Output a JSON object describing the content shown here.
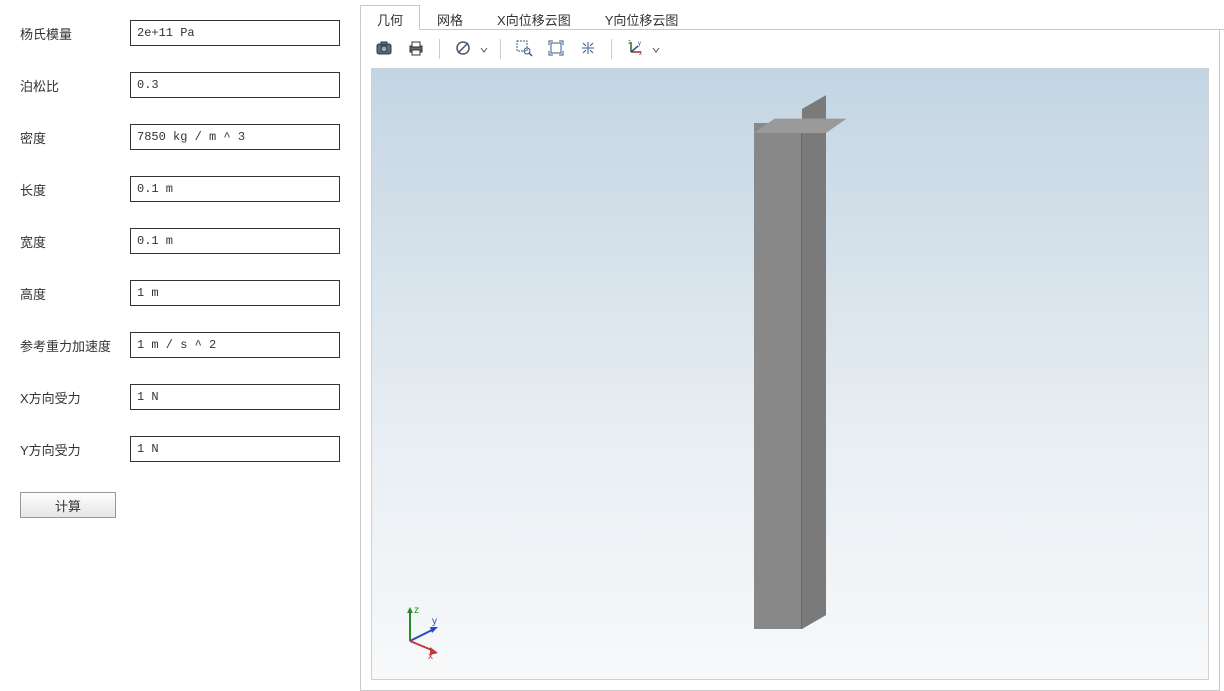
{
  "form": {
    "youngs_modulus": {
      "label": "杨氏模量",
      "value": "2e+11 Pa"
    },
    "poisson_ratio": {
      "label": "泊松比",
      "value": "0.3"
    },
    "density": {
      "label": "密度",
      "value": "7850 kg / m ^ 3"
    },
    "length": {
      "label": "长度",
      "value": "0.1 m"
    },
    "width": {
      "label": "宽度",
      "value": "0.1 m"
    },
    "height": {
      "label": "高度",
      "value": "1 m"
    },
    "gravity": {
      "label": "参考重力加速度",
      "value": "1 m / s ^ 2"
    },
    "force_x": {
      "label": "X方向受力",
      "value": "1 N"
    },
    "force_y": {
      "label": "Y方向受力",
      "value": "1 N"
    }
  },
  "compute_button": "计算",
  "tabs": {
    "geometry": "几何",
    "mesh": "网格",
    "x_disp": "X向位移云图",
    "y_disp": "Y向位移云图"
  },
  "toolbar": {
    "snapshot": "camera-icon",
    "print": "print-icon",
    "transparency": "transparency-icon",
    "zoom_box": "zoom-box-icon",
    "zoom_extents": "zoom-extents-icon",
    "zoom_selected": "zoom-selected-icon",
    "view_orientation": "axes-orientation-icon"
  },
  "axes_labels": {
    "x": "x",
    "y": "y",
    "z": "z"
  }
}
